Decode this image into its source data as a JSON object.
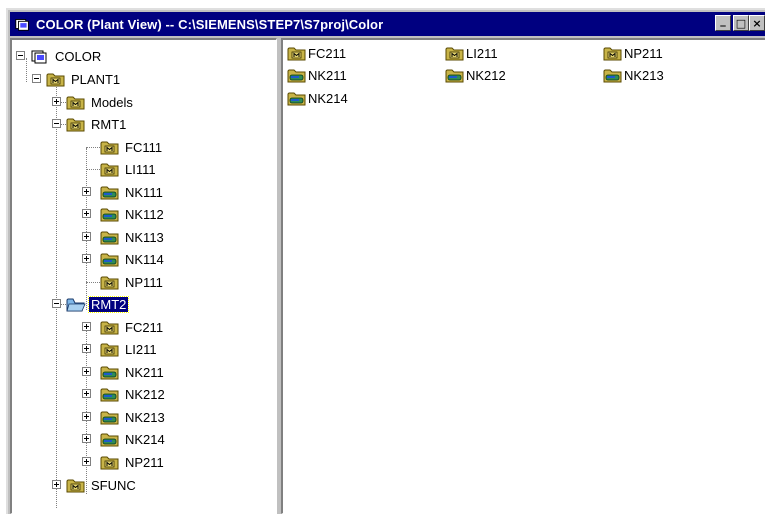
{
  "window": {
    "title": "COLOR  (Plant View) -- C:\\SIEMENS\\STEP7\\S7proj\\Color",
    "buttons": {
      "minimize": "_",
      "maximize": "□",
      "close": "×"
    }
  },
  "tree": {
    "root": "COLOR",
    "plant": "PLANT1",
    "models": "Models",
    "rmt1": {
      "label": "RMT1",
      "children": [
        "FC111",
        "LI111",
        "NK111",
        "NK112",
        "NK113",
        "NK114",
        "NP111"
      ]
    },
    "rmt2": {
      "label": "RMT2",
      "children": [
        "FC211",
        "LI211",
        "NK211",
        "NK212",
        "NK213",
        "NK214",
        "NP211"
      ]
    },
    "sfunc": "SFUNC"
  },
  "content": {
    "items": [
      {
        "label": "FC211",
        "icon": "function-folder-icon"
      },
      {
        "label": "LI211",
        "icon": "function-folder-icon"
      },
      {
        "label": "NP211",
        "icon": "function-folder-icon"
      },
      {
        "label": "NK211",
        "icon": "network-folder-icon"
      },
      {
        "label": "NK212",
        "icon": "network-folder-icon"
      },
      {
        "label": "NK213",
        "icon": "network-folder-icon"
      },
      {
        "label": "NK214",
        "icon": "network-folder-icon"
      }
    ]
  },
  "colors": {
    "titlebar": "#000080",
    "selection": "#000080",
    "folder": "#c8b448",
    "chip": "#2e8b57"
  }
}
